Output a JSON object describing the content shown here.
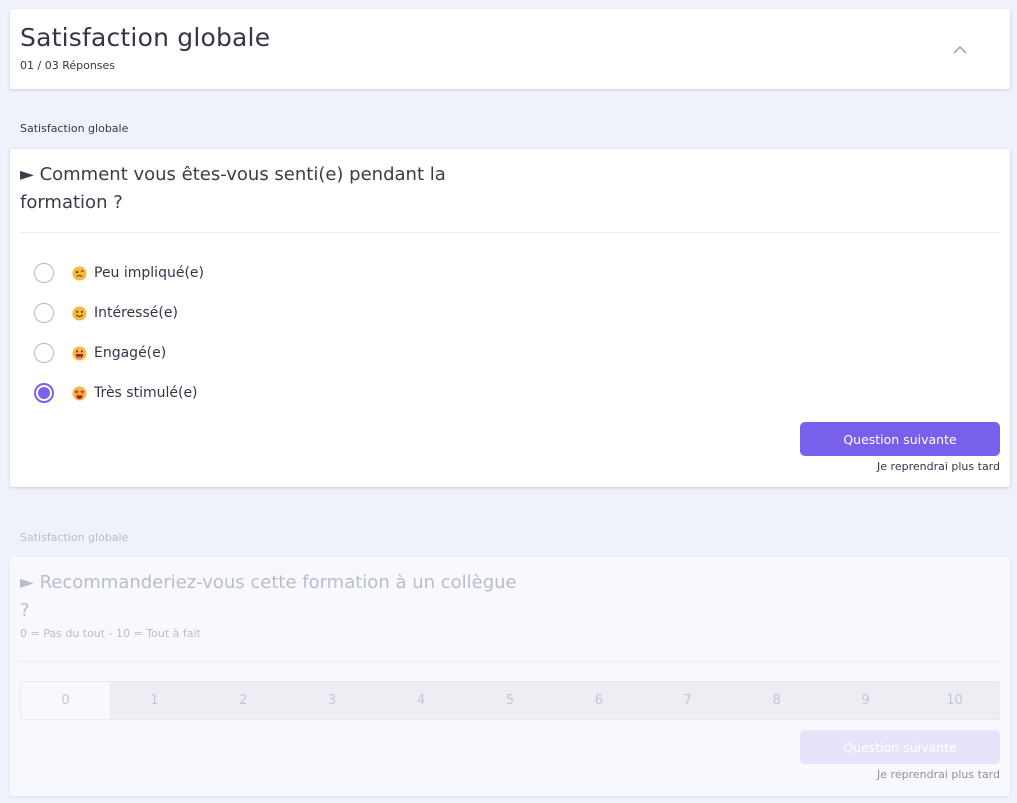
{
  "header": {
    "title": "Satisfaction globale",
    "subtitle": "01 / 03 Réponses"
  },
  "question1": {
    "section_label": "Satisfaction globale",
    "title": "► Comment vous êtes-vous senti(e) pendant la formation ?",
    "options": [
      {
        "label": "Peu impliqué(e)",
        "icon": "woozy-face-icon",
        "checked": false
      },
      {
        "label": "Intéressé(e)",
        "icon": "smiling-face-icon",
        "checked": false
      },
      {
        "label": "Engagé(e)",
        "icon": "grinning-face-icon",
        "checked": false
      },
      {
        "label": "Très stimulé(e)",
        "icon": "star-struck-face-icon",
        "checked": true
      }
    ],
    "next_label": "Question suivante",
    "later_label": "Je reprendrai plus tard"
  },
  "question2": {
    "section_label": "Satisfaction globale",
    "title": "► Recommanderiez-vous cette formation à un collègue ?",
    "hint": "0 = Pas du tout - 10 = Tout à fait",
    "scale": [
      "0",
      "1",
      "2",
      "3",
      "4",
      "5",
      "6",
      "7",
      "8",
      "9",
      "10"
    ],
    "next_label": "Question suivante",
    "later_label": "Je reprendrai plus tard"
  },
  "colors": {
    "accent": "#7860ec",
    "background": "#eff2fb"
  }
}
